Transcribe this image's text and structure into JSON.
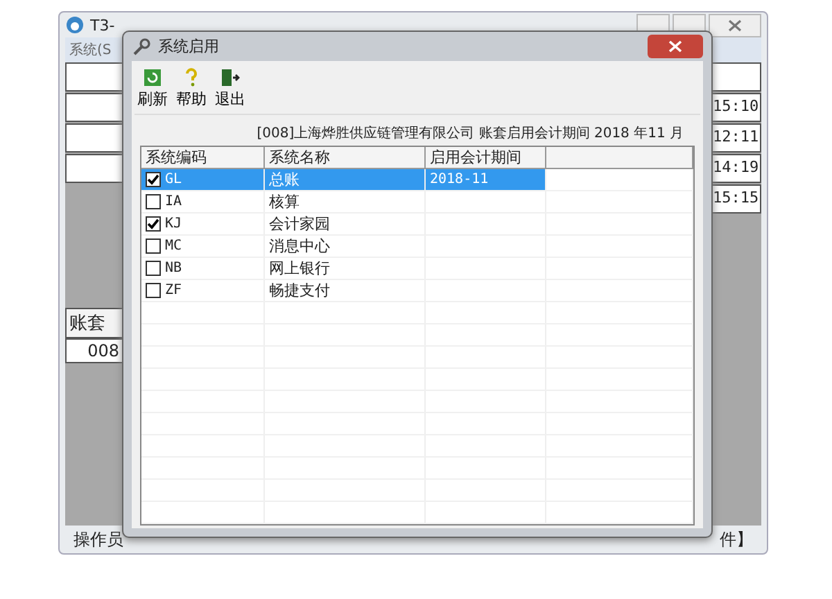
{
  "back_window": {
    "title": "T3-",
    "menu": "系统(S",
    "times": [
      "15:10",
      "12:11",
      "14:19",
      "15:15"
    ],
    "account_header": "账套",
    "account_value": "008",
    "status_left": "操作员",
    "status_right": "件】"
  },
  "dialog": {
    "title": "系统启用",
    "toolbar": [
      {
        "kind": "refresh",
        "label": "刷新"
      },
      {
        "kind": "help",
        "label": "帮助"
      },
      {
        "kind": "exit",
        "label": "退出"
      }
    ],
    "info": "[008]上海烨胜供应链管理有限公司 账套启用会计期间 2018 年11 月",
    "table": {
      "columns": [
        "系统编码",
        "系统名称",
        "启用会计期间"
      ],
      "rows": [
        {
          "code": "GL",
          "name": "总账",
          "period": "2018-11",
          "checked": true,
          "selected": true
        },
        {
          "code": "IA",
          "name": "核算",
          "checked": false,
          "selected": false
        },
        {
          "code": "KJ",
          "name": "会计家园",
          "checked": true,
          "selected": false
        },
        {
          "code": "MC",
          "name": "消息中心",
          "checked": false,
          "selected": false
        },
        {
          "code": "NB",
          "name": "网上银行",
          "checked": false,
          "selected": false
        },
        {
          "code": "ZF",
          "name": "畅捷支付",
          "checked": false,
          "selected": false
        }
      ]
    }
  }
}
